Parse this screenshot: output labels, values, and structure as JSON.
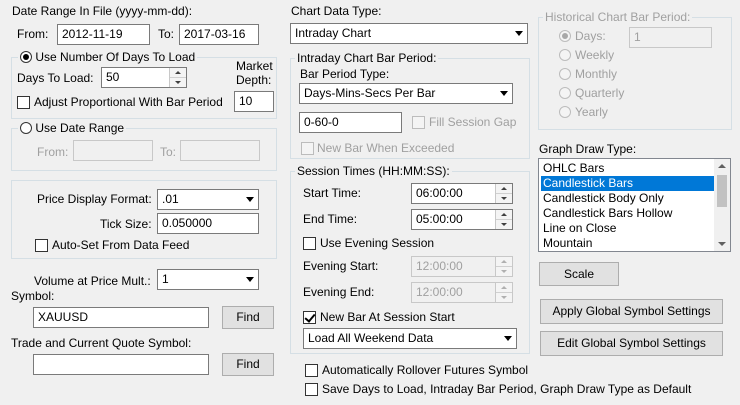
{
  "date_range": {
    "title": "Date Range In File (yyyy-mm-dd):",
    "from_label": "From:",
    "from_value": "2012-11-19",
    "to_label": "To:",
    "to_value": "2017-03-16"
  },
  "days_to_load": {
    "radio_label": "Use Number Of Days To Load",
    "days_label": "Days To Load:",
    "days_value": "50",
    "market_depth_label_1": "Market",
    "market_depth_label_2": "Depth:",
    "market_depth_value": "10",
    "adjust_label": "Adjust Proportional With Bar Period"
  },
  "date_range_option": {
    "radio_label": "Use Date Range",
    "from_label": "From:",
    "to_label": "To:"
  },
  "price": {
    "format_label": "Price Display Format:",
    "format_value": ".01",
    "tick_label": "Tick Size:",
    "tick_value": "0.050000",
    "autoset_label": "Auto-Set From Data Feed"
  },
  "volume": {
    "label": "Volume at Price Mult.:",
    "value": "1"
  },
  "symbol": {
    "label": "Symbol:",
    "value": "XAUUSD",
    "find_label": "Find"
  },
  "quote_symbol": {
    "label": "Trade and Current Quote Symbol:",
    "value": "",
    "find_label": "Find"
  },
  "chart_data_type": {
    "label": "Chart Data Type:",
    "value": "Intraday Chart"
  },
  "intraday_period": {
    "title": "Intraday Chart Bar Period:",
    "type_label": "Bar Period Type:",
    "type_value": "Days-Mins-Secs Per Bar",
    "period_value": "0-60-0",
    "fill_gap_label": "Fill Session Gap",
    "new_bar_exceeded_label": "New Bar When Exceeded"
  },
  "session_times": {
    "title": "Session Times (HH:MM:SS):",
    "start_label": "Start Time:",
    "start_value": "06:00:00",
    "end_label": "End Time:",
    "end_value": "05:00:00",
    "evening_label": "Use Evening Session",
    "evening_start_label": "Evening Start:",
    "evening_start_value": "12:00:00",
    "evening_end_label": "Evening End:",
    "evening_end_value": "12:00:00",
    "new_bar_label": "New Bar At Session Start",
    "weekend_value": "Load All Weekend Data"
  },
  "rollover_label": "Automatically Rollover Futures Symbol",
  "save_default_label": "Save Days to Load, Intraday Bar Period, Graph Draw Type as Default",
  "historical_period": {
    "title": "Historical Chart Bar Period:",
    "options": [
      "Days:",
      "Weekly",
      "Monthly",
      "Quarterly",
      "Yearly"
    ],
    "days_value": "1"
  },
  "graph_draw_type": {
    "label": "Graph Draw Type:",
    "items": [
      "OHLC Bars",
      "Candlestick Bars",
      "Candlestick Body Only",
      "Candlestick Bars Hollow",
      "Line on Close",
      "Mountain"
    ],
    "selected": "Candlestick Bars"
  },
  "buttons": {
    "scale": "Scale",
    "apply_global": "Apply Global Symbol Settings",
    "edit_global": "Edit Global Symbol Settings"
  },
  "colors": {
    "background": "#f0f0f0",
    "selection": "#0078d7",
    "group_border": "#d5dfe5"
  }
}
